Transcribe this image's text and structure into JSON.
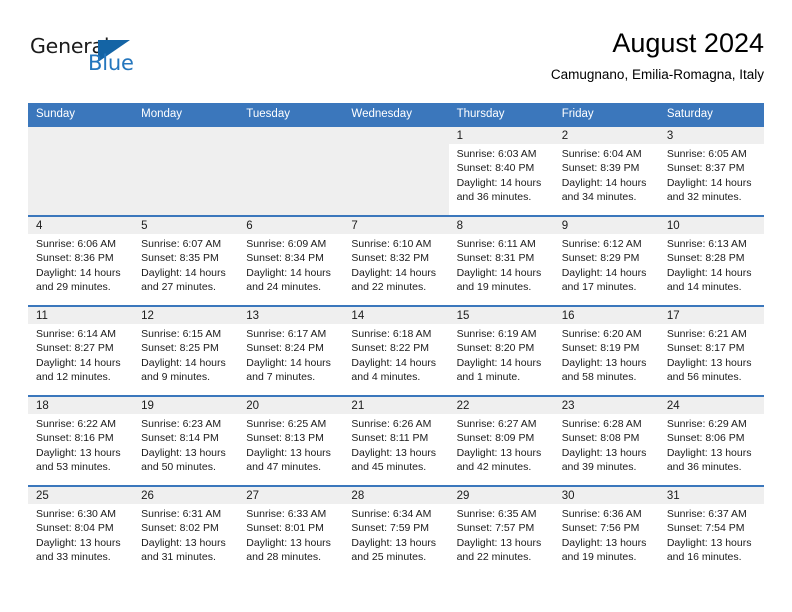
{
  "brand": {
    "name_part1": "General",
    "name_part2": "Blue",
    "accent_color": "#2476bd",
    "triangle_color": "#1464a5"
  },
  "header": {
    "month_title": "August 2024",
    "location": "Camugnano, Emilia-Romagna, Italy"
  },
  "calendar": {
    "header_bg": "#3b77bc",
    "weekdays": [
      "Sunday",
      "Monday",
      "Tuesday",
      "Wednesday",
      "Thursday",
      "Friday",
      "Saturday"
    ],
    "weeks": [
      [
        {
          "day": "",
          "empty": true
        },
        {
          "day": "",
          "empty": true
        },
        {
          "day": "",
          "empty": true
        },
        {
          "day": "",
          "empty": true
        },
        {
          "day": "1",
          "sunrise": "Sunrise: 6:03 AM",
          "sunset": "Sunset: 8:40 PM",
          "daylight": "Daylight: 14 hours and 36 minutes."
        },
        {
          "day": "2",
          "sunrise": "Sunrise: 6:04 AM",
          "sunset": "Sunset: 8:39 PM",
          "daylight": "Daylight: 14 hours and 34 minutes."
        },
        {
          "day": "3",
          "sunrise": "Sunrise: 6:05 AM",
          "sunset": "Sunset: 8:37 PM",
          "daylight": "Daylight: 14 hours and 32 minutes."
        }
      ],
      [
        {
          "day": "4",
          "sunrise": "Sunrise: 6:06 AM",
          "sunset": "Sunset: 8:36 PM",
          "daylight": "Daylight: 14 hours and 29 minutes."
        },
        {
          "day": "5",
          "sunrise": "Sunrise: 6:07 AM",
          "sunset": "Sunset: 8:35 PM",
          "daylight": "Daylight: 14 hours and 27 minutes."
        },
        {
          "day": "6",
          "sunrise": "Sunrise: 6:09 AM",
          "sunset": "Sunset: 8:34 PM",
          "daylight": "Daylight: 14 hours and 24 minutes."
        },
        {
          "day": "7",
          "sunrise": "Sunrise: 6:10 AM",
          "sunset": "Sunset: 8:32 PM",
          "daylight": "Daylight: 14 hours and 22 minutes."
        },
        {
          "day": "8",
          "sunrise": "Sunrise: 6:11 AM",
          "sunset": "Sunset: 8:31 PM",
          "daylight": "Daylight: 14 hours and 19 minutes."
        },
        {
          "day": "9",
          "sunrise": "Sunrise: 6:12 AM",
          "sunset": "Sunset: 8:29 PM",
          "daylight": "Daylight: 14 hours and 17 minutes."
        },
        {
          "day": "10",
          "sunrise": "Sunrise: 6:13 AM",
          "sunset": "Sunset: 8:28 PM",
          "daylight": "Daylight: 14 hours and 14 minutes."
        }
      ],
      [
        {
          "day": "11",
          "sunrise": "Sunrise: 6:14 AM",
          "sunset": "Sunset: 8:27 PM",
          "daylight": "Daylight: 14 hours and 12 minutes."
        },
        {
          "day": "12",
          "sunrise": "Sunrise: 6:15 AM",
          "sunset": "Sunset: 8:25 PM",
          "daylight": "Daylight: 14 hours and 9 minutes."
        },
        {
          "day": "13",
          "sunrise": "Sunrise: 6:17 AM",
          "sunset": "Sunset: 8:24 PM",
          "daylight": "Daylight: 14 hours and 7 minutes."
        },
        {
          "day": "14",
          "sunrise": "Sunrise: 6:18 AM",
          "sunset": "Sunset: 8:22 PM",
          "daylight": "Daylight: 14 hours and 4 minutes."
        },
        {
          "day": "15",
          "sunrise": "Sunrise: 6:19 AM",
          "sunset": "Sunset: 8:20 PM",
          "daylight": "Daylight: 14 hours and 1 minute."
        },
        {
          "day": "16",
          "sunrise": "Sunrise: 6:20 AM",
          "sunset": "Sunset: 8:19 PM",
          "daylight": "Daylight: 13 hours and 58 minutes."
        },
        {
          "day": "17",
          "sunrise": "Sunrise: 6:21 AM",
          "sunset": "Sunset: 8:17 PM",
          "daylight": "Daylight: 13 hours and 56 minutes."
        }
      ],
      [
        {
          "day": "18",
          "sunrise": "Sunrise: 6:22 AM",
          "sunset": "Sunset: 8:16 PM",
          "daylight": "Daylight: 13 hours and 53 minutes."
        },
        {
          "day": "19",
          "sunrise": "Sunrise: 6:23 AM",
          "sunset": "Sunset: 8:14 PM",
          "daylight": "Daylight: 13 hours and 50 minutes."
        },
        {
          "day": "20",
          "sunrise": "Sunrise: 6:25 AM",
          "sunset": "Sunset: 8:13 PM",
          "daylight": "Daylight: 13 hours and 47 minutes."
        },
        {
          "day": "21",
          "sunrise": "Sunrise: 6:26 AM",
          "sunset": "Sunset: 8:11 PM",
          "daylight": "Daylight: 13 hours and 45 minutes."
        },
        {
          "day": "22",
          "sunrise": "Sunrise: 6:27 AM",
          "sunset": "Sunset: 8:09 PM",
          "daylight": "Daylight: 13 hours and 42 minutes."
        },
        {
          "day": "23",
          "sunrise": "Sunrise: 6:28 AM",
          "sunset": "Sunset: 8:08 PM",
          "daylight": "Daylight: 13 hours and 39 minutes."
        },
        {
          "day": "24",
          "sunrise": "Sunrise: 6:29 AM",
          "sunset": "Sunset: 8:06 PM",
          "daylight": "Daylight: 13 hours and 36 minutes."
        }
      ],
      [
        {
          "day": "25",
          "sunrise": "Sunrise: 6:30 AM",
          "sunset": "Sunset: 8:04 PM",
          "daylight": "Daylight: 13 hours and 33 minutes."
        },
        {
          "day": "26",
          "sunrise": "Sunrise: 6:31 AM",
          "sunset": "Sunset: 8:02 PM",
          "daylight": "Daylight: 13 hours and 31 minutes."
        },
        {
          "day": "27",
          "sunrise": "Sunrise: 6:33 AM",
          "sunset": "Sunset: 8:01 PM",
          "daylight": "Daylight: 13 hours and 28 minutes."
        },
        {
          "day": "28",
          "sunrise": "Sunrise: 6:34 AM",
          "sunset": "Sunset: 7:59 PM",
          "daylight": "Daylight: 13 hours and 25 minutes."
        },
        {
          "day": "29",
          "sunrise": "Sunrise: 6:35 AM",
          "sunset": "Sunset: 7:57 PM",
          "daylight": "Daylight: 13 hours and 22 minutes."
        },
        {
          "day": "30",
          "sunrise": "Sunrise: 6:36 AM",
          "sunset": "Sunset: 7:56 PM",
          "daylight": "Daylight: 13 hours and 19 minutes."
        },
        {
          "day": "31",
          "sunrise": "Sunrise: 6:37 AM",
          "sunset": "Sunset: 7:54 PM",
          "daylight": "Daylight: 13 hours and 16 minutes."
        }
      ]
    ]
  }
}
